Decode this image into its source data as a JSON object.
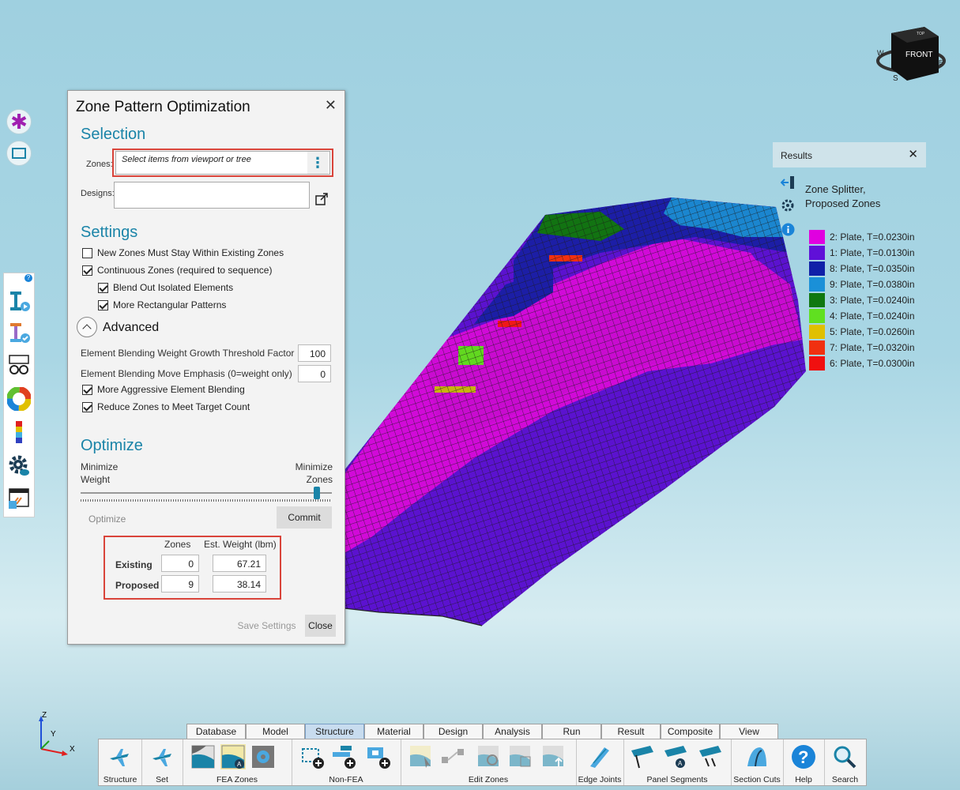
{
  "dialog": {
    "title": "Zone Pattern Optimization",
    "close_glyph": "✕",
    "selection": {
      "heading": "Selection",
      "zones_label": "Zones:",
      "zones_placeholder": "Select items from viewport or tree",
      "designs_label": "Designs:"
    },
    "settings": {
      "heading": "Settings",
      "new_zones_within": {
        "label": "New Zones Must Stay Within Existing Zones",
        "checked": false
      },
      "continuous_zones": {
        "label": "Continuous Zones (required to sequence)",
        "checked": true
      },
      "blend_out": {
        "label": "Blend Out Isolated Elements",
        "checked": true
      },
      "more_rectangular": {
        "label": "More Rectangular Patterns",
        "checked": true
      }
    },
    "advanced": {
      "heading": "Advanced",
      "growth_label": "Element Blending Weight Growth Threshold Factor",
      "growth_value": "100",
      "move_label": "Element Blending Move Emphasis (0=weight only)",
      "move_value": "0",
      "aggressive": {
        "label": "More Aggressive Element Blending",
        "checked": true
      },
      "reduce_zones": {
        "label": "Reduce Zones to Meet Target Count",
        "checked": true
      }
    },
    "optimize": {
      "heading": "Optimize",
      "left_label_1": "Minimize",
      "left_label_2": "Weight",
      "right_label_1": "Minimize",
      "right_label_2": "Zones",
      "slider_value": 0.94,
      "optimize_button": "Optimize",
      "commit_button": "Commit"
    },
    "summary": {
      "col_zones": "Zones",
      "col_weight": "Est. Weight (lbm)",
      "rows": [
        {
          "label": "Existing",
          "zones": "0",
          "weight": "67.21"
        },
        {
          "label": "Proposed",
          "zones": "9",
          "weight": "38.14"
        }
      ]
    },
    "save_settings": "Save Settings",
    "close_button": "Close"
  },
  "results": {
    "title": "Results",
    "close_glyph": "✕",
    "line1": "Zone Splitter,",
    "line2": "Proposed Zones",
    "legend": [
      {
        "label": "2: Plate, T=0.0230in",
        "color": "#e000e0"
      },
      {
        "label": "1: Plate, T=0.0130in",
        "color": "#6010d8"
      },
      {
        "label": "8: Plate, T=0.0350in",
        "color": "#1020a8"
      },
      {
        "label": "9: Plate, T=0.0380in",
        "color": "#1a90d8"
      },
      {
        "label": "3: Plate, T=0.0240in",
        "color": "#107810"
      },
      {
        "label": "4: Plate, T=0.0240in",
        "color": "#60e020"
      },
      {
        "label": "5: Plate, T=0.0260in",
        "color": "#e0c000"
      },
      {
        "label": "7: Plate, T=0.0320in",
        "color": "#f03010"
      },
      {
        "label": "6: Plate, T=0.0300in",
        "color": "#f01010"
      }
    ]
  },
  "viewcube": {
    "front": "FRONT",
    "top": "TOP",
    "w": "W",
    "s": "S",
    "e": "E"
  },
  "axes": {
    "z": "Z",
    "y": "Y",
    "x": "X"
  },
  "ribbon": {
    "tabs": [
      "Database",
      "Model",
      "Structure",
      "Material",
      "Design",
      "Analysis",
      "Run",
      "Result",
      "Composite",
      "View"
    ],
    "active_tab": "Structure",
    "groups": [
      "Structure",
      "Set",
      "FEA Zones",
      "Non-FEA",
      "Edit Zones",
      "Edge Joints",
      "Panel Segments",
      "Section Cuts",
      "Help",
      "Search"
    ]
  }
}
